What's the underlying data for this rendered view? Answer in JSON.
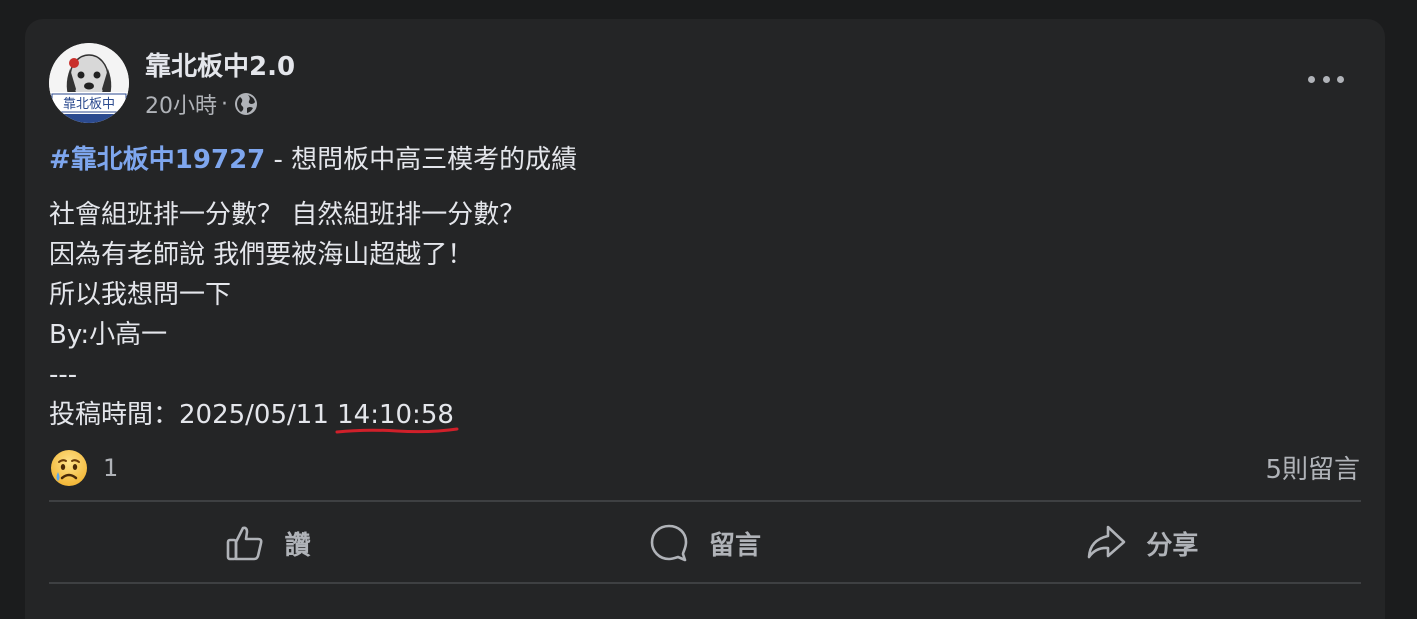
{
  "post": {
    "page_name": "靠北板中2.0",
    "avatar_text": "靠北板中",
    "time": "20小時",
    "separator": "·",
    "visibility_icon": "globe-icon",
    "hashtag": "#靠北板中",
    "hashtag_number": "19727",
    "title_rest": " - 想問板中高三模考的成績",
    "body_lines": [
      "社會組班排一分數？ 自然組班排一分數？",
      "因為有老師說 我們要被海山超越了！",
      "所以我想問一下",
      "By:小高一",
      "---"
    ],
    "submitted_label": "投稿時間：2025/05/11 ",
    "submitted_time": "14:10:58",
    "underline_color": "#d0202a"
  },
  "engagement": {
    "reaction_icon": "sad-face-emoji",
    "reaction_count": "1",
    "comment_count": "5則留言"
  },
  "actions": {
    "like_label": "讚",
    "comment_label": "留言",
    "share_label": "分享"
  }
}
